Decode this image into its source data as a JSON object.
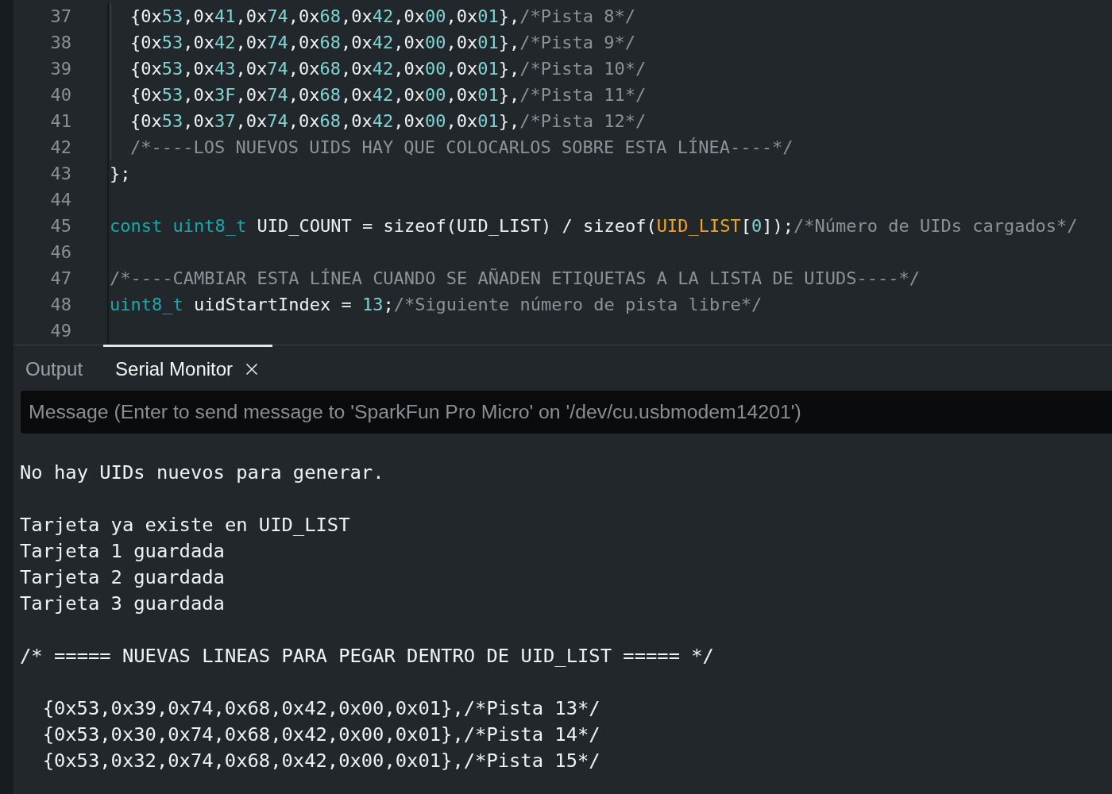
{
  "editor": {
    "lines": [
      {
        "number": "37",
        "indented": true,
        "tokens": [
          {
            "kind": "plain",
            "text": "{0x"
          },
          {
            "kind": "number",
            "text": "53"
          },
          {
            "kind": "plain",
            "text": ",0x"
          },
          {
            "kind": "number",
            "text": "41"
          },
          {
            "kind": "plain",
            "text": ",0x"
          },
          {
            "kind": "number",
            "text": "74"
          },
          {
            "kind": "plain",
            "text": ",0x"
          },
          {
            "kind": "number",
            "text": "68"
          },
          {
            "kind": "plain",
            "text": ",0x"
          },
          {
            "kind": "number",
            "text": "42"
          },
          {
            "kind": "plain",
            "text": ",0x"
          },
          {
            "kind": "number",
            "text": "00"
          },
          {
            "kind": "plain",
            "text": ",0x"
          },
          {
            "kind": "number",
            "text": "01"
          },
          {
            "kind": "plain",
            "text": "},"
          },
          {
            "kind": "comment",
            "text": "/*Pista 8*/"
          }
        ]
      },
      {
        "number": "38",
        "indented": true,
        "tokens": [
          {
            "kind": "plain",
            "text": "{0x"
          },
          {
            "kind": "number",
            "text": "53"
          },
          {
            "kind": "plain",
            "text": ",0x"
          },
          {
            "kind": "number",
            "text": "42"
          },
          {
            "kind": "plain",
            "text": ",0x"
          },
          {
            "kind": "number",
            "text": "74"
          },
          {
            "kind": "plain",
            "text": ",0x"
          },
          {
            "kind": "number",
            "text": "68"
          },
          {
            "kind": "plain",
            "text": ",0x"
          },
          {
            "kind": "number",
            "text": "42"
          },
          {
            "kind": "plain",
            "text": ",0x"
          },
          {
            "kind": "number",
            "text": "00"
          },
          {
            "kind": "plain",
            "text": ",0x"
          },
          {
            "kind": "number",
            "text": "01"
          },
          {
            "kind": "plain",
            "text": "},"
          },
          {
            "kind": "comment",
            "text": "/*Pista 9*/"
          }
        ]
      },
      {
        "number": "39",
        "indented": true,
        "tokens": [
          {
            "kind": "plain",
            "text": "{0x"
          },
          {
            "kind": "number",
            "text": "53"
          },
          {
            "kind": "plain",
            "text": ",0x"
          },
          {
            "kind": "number",
            "text": "43"
          },
          {
            "kind": "plain",
            "text": ",0x"
          },
          {
            "kind": "number",
            "text": "74"
          },
          {
            "kind": "plain",
            "text": ",0x"
          },
          {
            "kind": "number",
            "text": "68"
          },
          {
            "kind": "plain",
            "text": ",0x"
          },
          {
            "kind": "number",
            "text": "42"
          },
          {
            "kind": "plain",
            "text": ",0x"
          },
          {
            "kind": "number",
            "text": "00"
          },
          {
            "kind": "plain",
            "text": ",0x"
          },
          {
            "kind": "number",
            "text": "01"
          },
          {
            "kind": "plain",
            "text": "},"
          },
          {
            "kind": "comment",
            "text": "/*Pista 10*/"
          }
        ]
      },
      {
        "number": "40",
        "indented": true,
        "tokens": [
          {
            "kind": "plain",
            "text": "{0x"
          },
          {
            "kind": "number",
            "text": "53"
          },
          {
            "kind": "plain",
            "text": ",0x"
          },
          {
            "kind": "number",
            "text": "3F"
          },
          {
            "kind": "plain",
            "text": ",0x"
          },
          {
            "kind": "number",
            "text": "74"
          },
          {
            "kind": "plain",
            "text": ",0x"
          },
          {
            "kind": "number",
            "text": "68"
          },
          {
            "kind": "plain",
            "text": ",0x"
          },
          {
            "kind": "number",
            "text": "42"
          },
          {
            "kind": "plain",
            "text": ",0x"
          },
          {
            "kind": "number",
            "text": "00"
          },
          {
            "kind": "plain",
            "text": ",0x"
          },
          {
            "kind": "number",
            "text": "01"
          },
          {
            "kind": "plain",
            "text": "},"
          },
          {
            "kind": "comment",
            "text": "/*Pista 11*/"
          }
        ]
      },
      {
        "number": "41",
        "indented": true,
        "tokens": [
          {
            "kind": "plain",
            "text": "{0x"
          },
          {
            "kind": "number",
            "text": "53"
          },
          {
            "kind": "plain",
            "text": ",0x"
          },
          {
            "kind": "number",
            "text": "37"
          },
          {
            "kind": "plain",
            "text": ",0x"
          },
          {
            "kind": "number",
            "text": "74"
          },
          {
            "kind": "plain",
            "text": ",0x"
          },
          {
            "kind": "number",
            "text": "68"
          },
          {
            "kind": "plain",
            "text": ",0x"
          },
          {
            "kind": "number",
            "text": "42"
          },
          {
            "kind": "plain",
            "text": ",0x"
          },
          {
            "kind": "number",
            "text": "00"
          },
          {
            "kind": "plain",
            "text": ",0x"
          },
          {
            "kind": "number",
            "text": "01"
          },
          {
            "kind": "plain",
            "text": "},"
          },
          {
            "kind": "comment",
            "text": "/*Pista 12*/"
          }
        ]
      },
      {
        "number": "42",
        "indented": true,
        "tokens": [
          {
            "kind": "comment",
            "text": "/*----LOS NUEVOS UIDS HAY QUE COLOCARLOS SOBRE ESTA LÍNEA----*/"
          }
        ]
      },
      {
        "number": "43",
        "indented": false,
        "tokens": [
          {
            "kind": "plain",
            "text": "};"
          }
        ]
      },
      {
        "number": "44"
      },
      {
        "number": "45",
        "indented": false,
        "tokens": [
          {
            "kind": "keyword",
            "text": "const "
          },
          {
            "kind": "keyword",
            "text": "uint8_t"
          },
          {
            "kind": "plain",
            "text": " UID_COUNT = sizeof(UID_LIST) / sizeof("
          },
          {
            "kind": "constant",
            "text": "UID_LIST"
          },
          {
            "kind": "plain",
            "text": "["
          },
          {
            "kind": "number",
            "text": "0"
          },
          {
            "kind": "plain",
            "text": "]);"
          },
          {
            "kind": "comment",
            "text": "/*Número de UIDs cargados*/"
          }
        ]
      },
      {
        "number": "46"
      },
      {
        "number": "47",
        "indented": false,
        "tokens": [
          {
            "kind": "comment",
            "text": "/*----CAMBIAR ESTA LÍNEA CUANDO SE AÑADEN ETIQUETAS A LA LISTA DE UIUDS----*/"
          }
        ]
      },
      {
        "number": "48",
        "indented": false,
        "tokens": [
          {
            "kind": "keyword",
            "text": "uint8_t"
          },
          {
            "kind": "plain",
            "text": " uidStartIndex = "
          },
          {
            "kind": "number",
            "text": "13"
          },
          {
            "kind": "plain",
            "text": ";"
          },
          {
            "kind": "comment",
            "text": "/*Siguiente número de pista libre*/"
          }
        ]
      },
      {
        "number": "49"
      }
    ]
  },
  "panel": {
    "tabs": [
      {
        "label": "Output",
        "selected": false,
        "closable": false
      },
      {
        "label": "Serial Monitor",
        "selected": true,
        "closable": true
      }
    ],
    "message_field": {
      "placeholder": "Message (Enter to send message to 'SparkFun Pro Micro' on '/dev/cu.usbmodem14201')"
    },
    "output": {
      "blocks": [
        {
          "lines": [
            {
              "text": "No hay UIDs nuevos para generar.",
              "indented": false
            }
          ]
        },
        {
          "lines": [
            {
              "text": "Tarjeta ya existe en UID_LIST",
              "indented": false
            },
            {
              "text": "Tarjeta 1 guardada",
              "indented": false
            },
            {
              "text": "Tarjeta 2 guardada",
              "indented": false
            },
            {
              "text": "Tarjeta 3 guardada",
              "indented": false
            }
          ]
        },
        {
          "lines": [
            {
              "text": "/* ===== NUEVAS LINEAS PARA PEGAR DENTRO DE UID_LIST ===== */",
              "indented": false
            }
          ]
        },
        {
          "lines": [
            {
              "text": "{0x53,0x39,0x74,0x68,0x42,0x00,0x01},/*Pista 13*/",
              "indented": true
            },
            {
              "text": "{0x53,0x30,0x74,0x68,0x42,0x00,0x01},/*Pista 14*/",
              "indented": true
            },
            {
              "text": "{0x53,0x32,0x74,0x68,0x42,0x00,0x01},/*Pista 15*/",
              "indented": true
            }
          ]
        }
      ]
    }
  }
}
